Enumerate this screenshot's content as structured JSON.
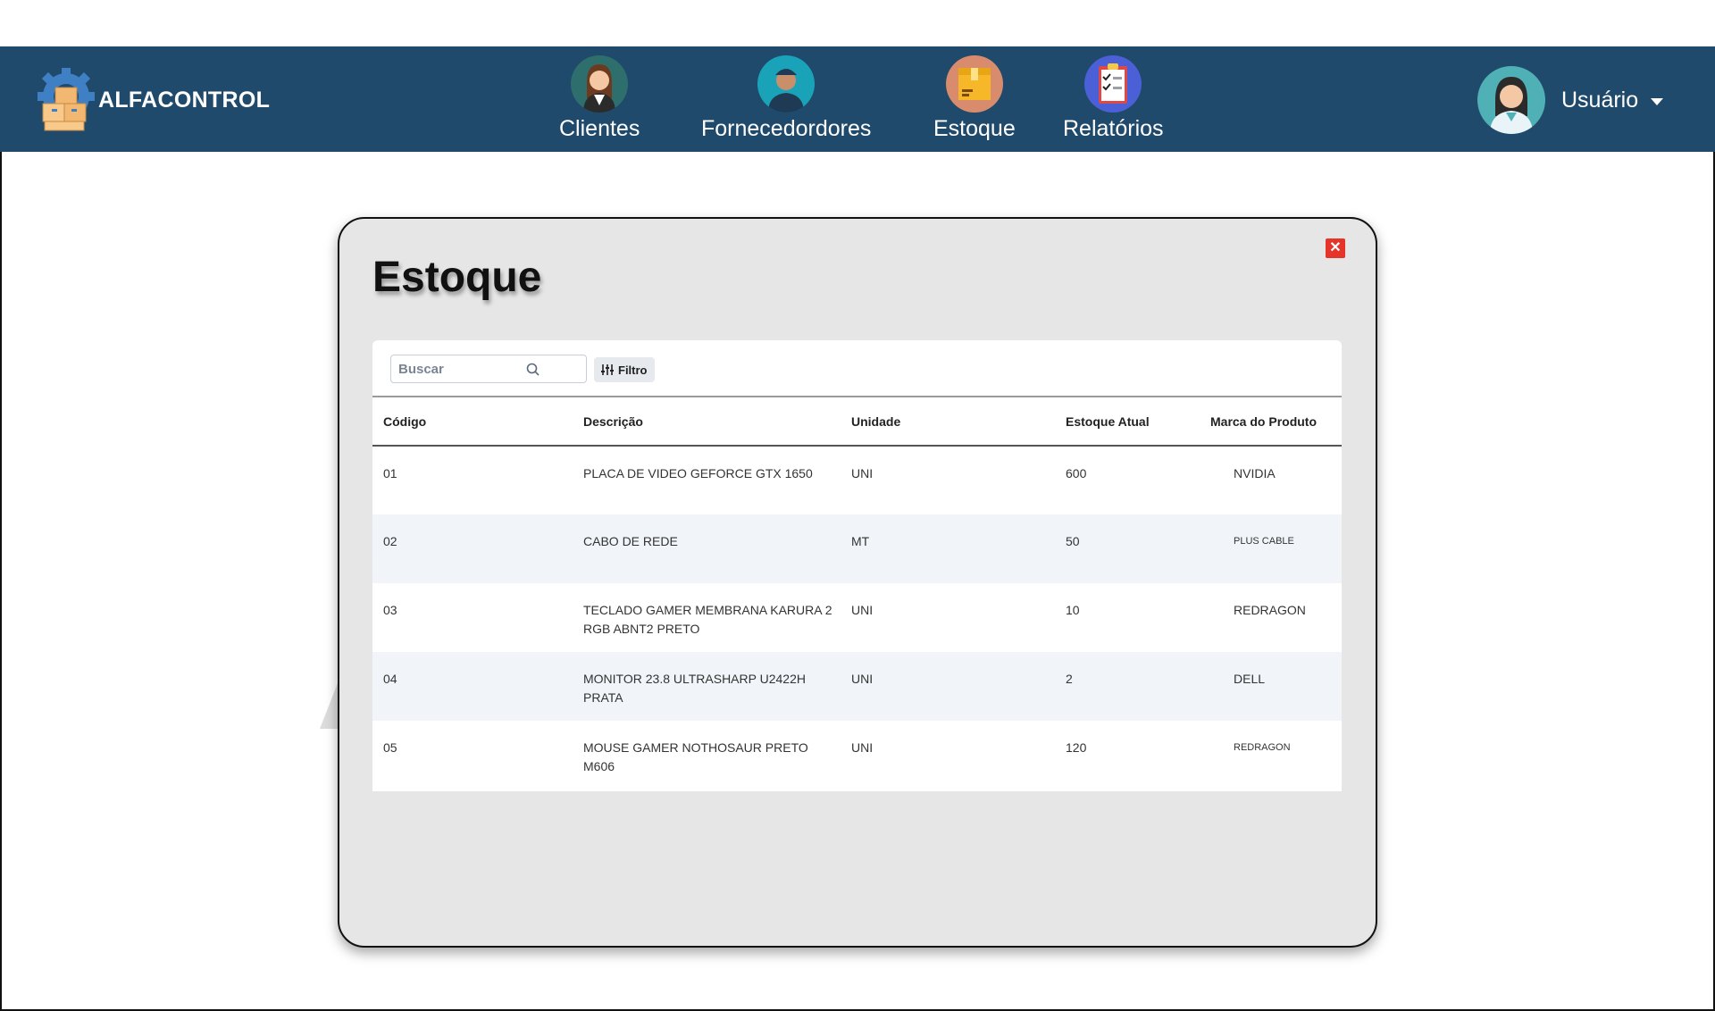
{
  "app": {
    "brand": "ALFACONTROL"
  },
  "nav": {
    "items": [
      {
        "label": "Clientes",
        "icon": "woman-client-icon"
      },
      {
        "label": "Fornecedordores",
        "icon": "man-supplier-icon"
      },
      {
        "label": "Estoque",
        "icon": "box-icon"
      },
      {
        "label": "Relatórios",
        "icon": "clipboard-icon"
      }
    ],
    "user": {
      "name": "Usuário",
      "icon": "user-avatar-icon"
    }
  },
  "modal": {
    "title": "Estoque",
    "close_label": "✕"
  },
  "toolbar": {
    "search_placeholder": "Buscar",
    "filter_label": "Filtro"
  },
  "table": {
    "headers": [
      "Código",
      "Descrição",
      "Unidade",
      "Estoque Atual",
      "Marca do Produto"
    ],
    "rows": [
      {
        "codigo": "01",
        "descricao": "PLACA DE VIDEO GEFORCE GTX 1650",
        "unidade": "UNI",
        "estoque": "600",
        "marca": "NVIDIA"
      },
      {
        "codigo": "02",
        "descricao": "CABO DE REDE",
        "unidade": "MT",
        "estoque": "50",
        "marca": "PLUS CABLE"
      },
      {
        "codigo": "03",
        "descricao": "TECLADO GAMER MEMBRANA KARURA 2 RGB ABNT2 PRETO",
        "unidade": "UNI",
        "estoque": "10",
        "marca": "REDRAGON"
      },
      {
        "codigo": "04",
        "descricao": "MONITOR 23.8 ULTRASHARP U2422H PRATA",
        "unidade": "UNI",
        "estoque": "2",
        "marca": "DELL"
      },
      {
        "codigo": "05",
        "descricao": "MOUSE GAMER NOTHOSAUR PRETO M606",
        "unidade": "UNI",
        "estoque": "120",
        "marca": "REDRAGON"
      }
    ]
  },
  "colors": {
    "navbar": "#1f4a6b",
    "close": "#e5342a",
    "modal_bg": "#e6e6e6"
  }
}
